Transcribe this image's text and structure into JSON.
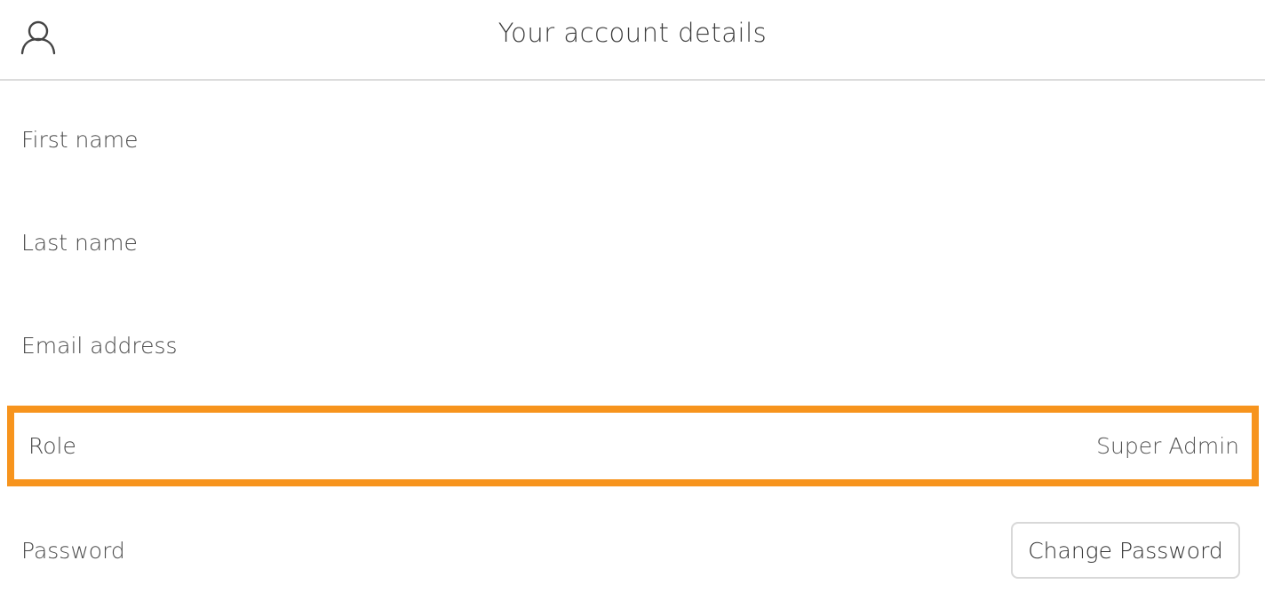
{
  "header": {
    "title": "Your account details",
    "icon": "user-icon"
  },
  "fields": {
    "first_name": {
      "label": "First name",
      "value": ""
    },
    "last_name": {
      "label": "Last name",
      "value": ""
    },
    "email": {
      "label": "Email address",
      "value": ""
    },
    "role": {
      "label": "Role",
      "value": "Super Admin"
    },
    "password": {
      "label": "Password",
      "button_label": "Change Password"
    }
  },
  "colors": {
    "highlight": "#f7941d",
    "divider": "#dcdcdc",
    "text": "#4a4a4a"
  }
}
